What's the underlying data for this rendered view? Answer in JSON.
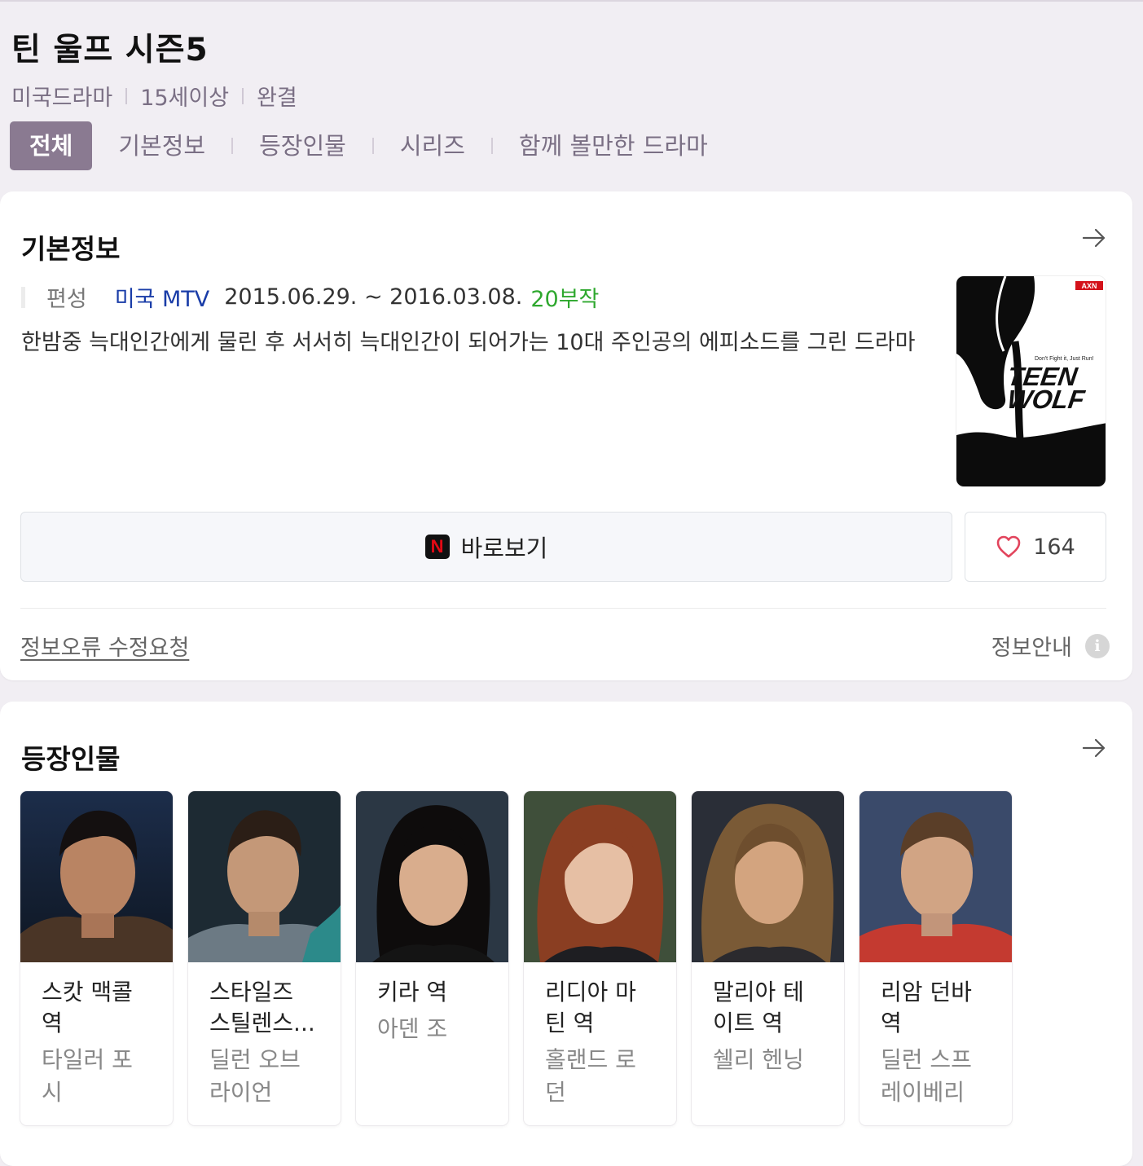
{
  "title": "틴 울프 시즌5",
  "meta": [
    "미국드라마",
    "15세이상",
    "완결"
  ],
  "tabs": [
    "전체",
    "기본정보",
    "등장인물",
    "시리즈",
    "함께 볼만한 드라마"
  ],
  "basic": {
    "section_title": "기본정보",
    "label": "편성",
    "network": "미국 MTV",
    "dates": "2015.06.29. ~ 2016.03.08.",
    "episodes": "20부작",
    "description": "한밤중 늑대인간에게 물린 후 서서히 늑대인간이 되어가는 10대 주인공의 에피소드를 그린 드라마",
    "poster": {
      "tagline": "Don't Fight it, Just Run!",
      "title_line1": "TEEN",
      "title_line2": "WOLF",
      "channel": "AXN"
    },
    "watch_label": "바로보기",
    "watch_icon_letter": "N",
    "like_count": "164",
    "report_label": "정보오류 수정요청",
    "guide_label": "정보안내"
  },
  "cast_section": {
    "title": "등장인물",
    "members": [
      {
        "role": "스캇 맥콜 역",
        "actor": "타일러 포시"
      },
      {
        "role": "스타일즈 스틸렌스...",
        "actor": "딜런 오브라이언"
      },
      {
        "role": "키라 역",
        "actor": "아덴 조"
      },
      {
        "role": "리디아 마틴 역",
        "actor": "홀랜드 로던"
      },
      {
        "role": "말리아 테이트 역",
        "actor": "쉘리 헨닝"
      },
      {
        "role": "리암 던바 역",
        "actor": "딜런 스프레이베리"
      }
    ]
  },
  "colors": {
    "accent": "#8a7a91",
    "network_blue": "#1a3da8",
    "episodes_green": "#2fa82f",
    "heart_red": "#e2445c",
    "netflix_red": "#e50914"
  }
}
